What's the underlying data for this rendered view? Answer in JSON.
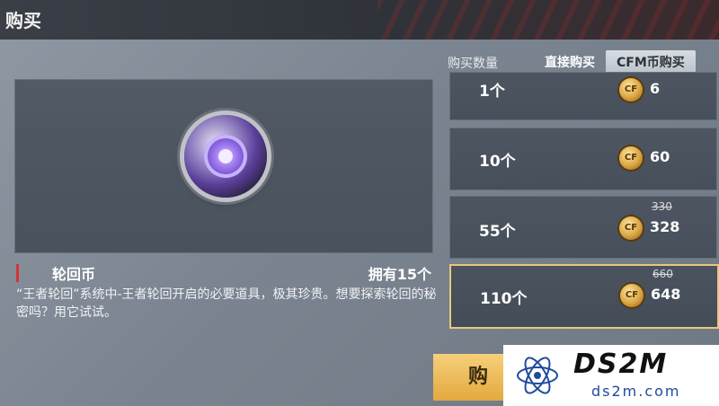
{
  "header": {
    "title": "购买"
  },
  "tabs": {
    "quantity_label": "购买数量",
    "items": [
      {
        "label": "直接购买",
        "active": false
      },
      {
        "label": "CFM币购买",
        "active": true
      }
    ]
  },
  "item": {
    "name": "轮回币",
    "owned": "拥有15个",
    "description": "“王者轮回”系统中-王者轮回开启的必要道具，极其珍贵。想要探索轮回的秘密吗？用它试试。"
  },
  "options": [
    {
      "qty": "1个",
      "price": "6",
      "old_price": ""
    },
    {
      "qty": "10个",
      "price": "60",
      "old_price": ""
    },
    {
      "qty": "55个",
      "price": "328",
      "old_price": "330"
    },
    {
      "qty": "110个",
      "price": "648",
      "old_price": "660",
      "selected": true
    }
  ],
  "currency_icon": "cf-coin-icon",
  "buy_button": {
    "label": "购"
  },
  "watermark": {
    "title": "DS2M",
    "url": "ds2m.com"
  },
  "colors": {
    "accent": "#e7c77f",
    "highlight": "#d6333a",
    "button": "#f6d07a"
  }
}
